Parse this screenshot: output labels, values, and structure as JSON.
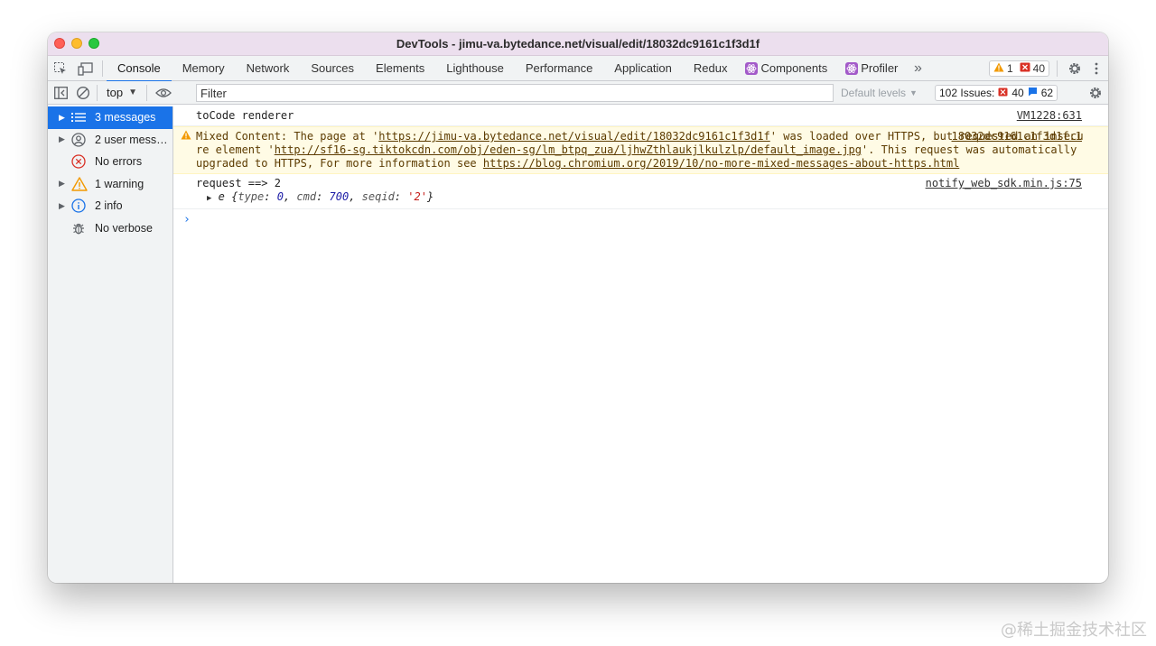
{
  "window": {
    "title": "DevTools - jimu-va.bytedance.net/visual/edit/18032dc9161c1f3d1f"
  },
  "tabs": [
    {
      "label": "Console",
      "active": true
    },
    {
      "label": "Memory"
    },
    {
      "label": "Network"
    },
    {
      "label": "Sources"
    },
    {
      "label": "Elements"
    },
    {
      "label": "Lighthouse"
    },
    {
      "label": "Performance"
    },
    {
      "label": "Application"
    },
    {
      "label": "Redux"
    },
    {
      "label": "Components"
    },
    {
      "label": "Profiler"
    }
  ],
  "badges": {
    "warnings": "1",
    "errors": "40"
  },
  "toolbar": {
    "context": "top",
    "filter_placeholder": "Filter",
    "levels": "Default levels",
    "issues_label": "102 Issues:",
    "issues_errors": "40",
    "issues_info": "62"
  },
  "sidebar": {
    "items": [
      {
        "label": "3 messages",
        "icon": "list-icon",
        "selected": true,
        "expandable": true
      },
      {
        "label": "2 user mess…",
        "icon": "user-icon",
        "expandable": true
      },
      {
        "label": "No errors",
        "icon": "error-icon",
        "expandable": false
      },
      {
        "label": "1 warning",
        "icon": "warning-icon",
        "expandable": true
      },
      {
        "label": "2 info",
        "icon": "info-icon",
        "expandable": true
      },
      {
        "label": "No verbose",
        "icon": "bug-icon",
        "expandable": false
      }
    ]
  },
  "console": {
    "msg1": {
      "text": "toCode renderer",
      "source": "VM1228:631"
    },
    "msg2": {
      "p1": "Mixed Content: The page at '",
      "url1": "https://jimu-va.bytedance.net/visual/edit/18032dc9161c1f3d1f",
      "p2": "' was loaded over HTTPS, but requested an insecure element '",
      "url2": "http://sf16-sg.tiktokcdn.com/obj/eden-sg/lm_btpq_zua/ljhwZthlaukjlkulzlp/default_image.jpg",
      "p3": "'. This request was automatically upgraded to HTTPS, For more information see ",
      "url3": "https://blog.chromium.org/2019/10/no-more-mixed-messages-about-https.html",
      "source": "18032dc9161c1f3d1f:1"
    },
    "msg3": {
      "text": "request ==> 2",
      "source": "notify_web_sdk.min.js:75",
      "obj_name": "e",
      "obj_k1": "type",
      "obj_v1": "0",
      "obj_k2": "cmd",
      "obj_v2": "700",
      "obj_k3": "seqid",
      "obj_v3": "'2'"
    }
  },
  "watermark": "@稀土掘金技术社区",
  "colors": {
    "accent": "#1a73e8",
    "warning_bg": "#fffbe5",
    "error": "#d93025",
    "warning": "#f29900"
  }
}
